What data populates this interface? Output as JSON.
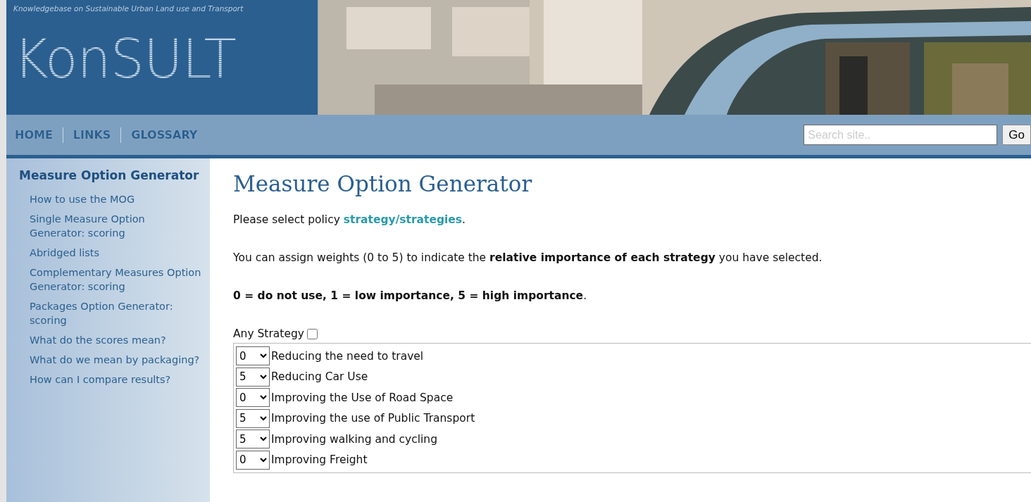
{
  "header": {
    "tagline": "Knowledgebase on Sustainable Urban Land use and Transport",
    "logo": "KonSULT"
  },
  "nav": {
    "links": [
      "HOME",
      "LINKS",
      "GLOSSARY"
    ],
    "search": {
      "placeholder": "Search site.."
    },
    "go_button": "Go"
  },
  "sidebar": {
    "title": "Measure Option Generator",
    "items": [
      "How to use the MOG",
      "Single Measure Option Generator: scoring",
      "Abridged lists",
      "Complementary Measures Option Generator: scoring",
      "Packages Option Generator: scoring",
      "What do the scores mean?",
      "What do we mean by packaging?",
      "How can I compare results?"
    ]
  },
  "content": {
    "title": "Measure Option Generator",
    "paragraphs": [
      {
        "text": "Please select policy ",
        "link": "strategy/strategies",
        "after": "."
      },
      {
        "text": "You can assign weights (0 to 5) to indicate the **relative importance of each strategy** you have selected."
      },
      {
        "text": "**0 = do not use, 1 = low importance, 5 = high importance**."
      }
    ],
    "any_strategy": {
      "label": "Any Strategy",
      "checked": false
    },
    "strategies": [
      {
        "weight": "0",
        "name": "Reducing the need to travel"
      },
      {
        "weight": "5",
        "name": "Reducing Car Use"
      },
      {
        "weight": "0",
        "name": "Improving the Use of Road Space"
      },
      {
        "weight": "5",
        "name": "Improving the use of Public Transport"
      },
      {
        "weight": "5",
        "name": "Improving walking and cycling"
      },
      {
        "weight": "0",
        "name": "Improving Freight"
      }
    ]
  }
}
